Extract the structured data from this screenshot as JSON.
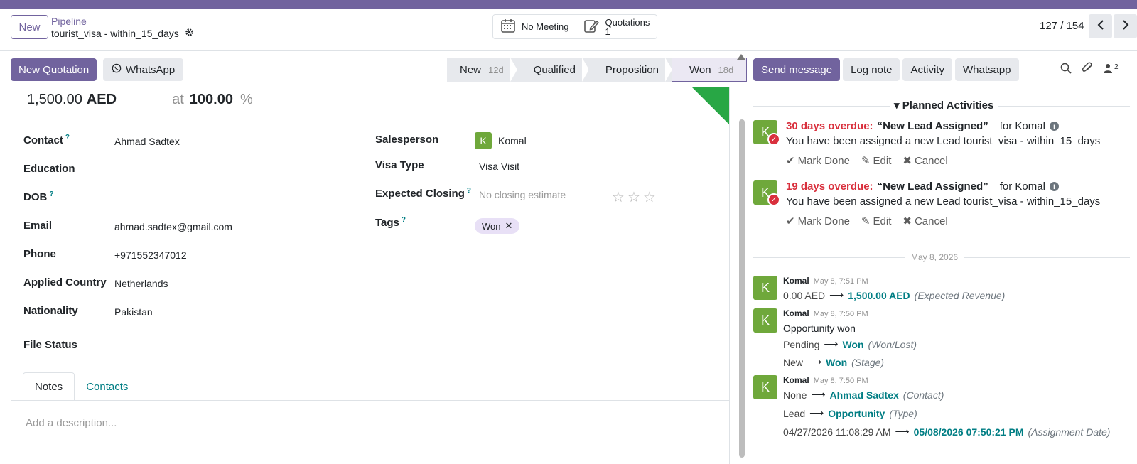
{
  "header": {
    "new_label": "New",
    "breadcrumb_parent": "Pipeline",
    "record_name": "tourist_visa - within_15_days",
    "smart_buttons": {
      "meeting": "No Meeting",
      "quotations_label": "Quotations",
      "quotations_count": "1"
    },
    "pager": "127 / 154"
  },
  "toolbar": {
    "new_quotation": "New Quotation",
    "whatsapp": "WhatsApp"
  },
  "stages": [
    {
      "label": "New",
      "duration": "12d"
    },
    {
      "label": "Qualified",
      "duration": ""
    },
    {
      "label": "Proposition",
      "duration": ""
    },
    {
      "label": "Won",
      "duration": "18d"
    }
  ],
  "form": {
    "revenue": "1,500.00",
    "currency": "AED",
    "at": "at",
    "probability": "100.00",
    "percent": "%",
    "left_fields": [
      {
        "label": "Contact",
        "help": "?",
        "value": "Ahmad Sadtex"
      },
      {
        "label": "Education",
        "value": ""
      },
      {
        "label": "DOB",
        "help": "?",
        "value": ""
      },
      {
        "label": "Email",
        "value": "ahmad.sadtex@gmail.com"
      },
      {
        "label": "Phone",
        "value": "+971552347012"
      },
      {
        "label": "Applied Country",
        "value": "Netherlands"
      },
      {
        "label": "Nationality",
        "value": "Pakistan"
      },
      {
        "label": "File Status",
        "value": ""
      }
    ],
    "salesperson_label": "Salesperson",
    "salesperson_initial": "K",
    "salesperson": "Komal",
    "visa_type_label": "Visa Type",
    "visa_type": "Visa Visit",
    "expected_closing_label": "Expected Closing",
    "expected_closing_help": "?",
    "expected_closing_placeholder": "No closing estimate",
    "priority_stars": 0,
    "tags_label": "Tags",
    "tags_help": "?",
    "tag": "Won",
    "tabs": [
      "Notes",
      "Contacts"
    ],
    "description_placeholder": "Add a description..."
  },
  "chatter": {
    "buttons": [
      "Send message",
      "Log note",
      "Activity",
      "Whatsapp"
    ],
    "followers_count": "2",
    "planned_title": "Planned Activities",
    "activities": [
      {
        "overdue": "30 days overdue:",
        "name": "“New Lead Assigned”",
        "for": "for Komal",
        "body": "You have been assigned a new Lead tourist_visa - within_15_days",
        "mark_done": "Mark Done",
        "edit": "Edit",
        "cancel": "Cancel"
      },
      {
        "overdue": "19 days overdue:",
        "name": "“New Lead Assigned”",
        "for": "for Komal",
        "body": "You have been assigned a new Lead tourist_visa - within_15_days",
        "mark_done": "Mark Done",
        "edit": "Edit",
        "cancel": "Cancel"
      }
    ],
    "date_separator": "May 8, 2026",
    "messages": [
      {
        "author": "Komal",
        "time": "May 8, 7:51 PM",
        "lines": [
          {
            "old": "0.00 AED",
            "new": "1,500.00 AED",
            "field": "(Expected Revenue)"
          }
        ]
      },
      {
        "author": "Komal",
        "time": "May 8, 7:50 PM",
        "text": "Opportunity won",
        "lines": [
          {
            "old": "Pending",
            "new": "Won",
            "field": "(Won/Lost)"
          },
          {
            "old": "New",
            "new": "Won",
            "field": "(Stage)"
          }
        ]
      },
      {
        "author": "Komal",
        "time": "May 8, 7:50 PM",
        "lines": [
          {
            "old": "None",
            "new": "Ahmad Sadtex",
            "field": "(Contact)"
          },
          {
            "old": "Lead",
            "new": "Opportunity",
            "field": "(Type)"
          },
          {
            "old": "04/27/2026 11:08:29 AM",
            "new": "05/08/2026 07:50:21 PM",
            "field": "(Assignment Date)"
          }
        ]
      }
    ]
  }
}
